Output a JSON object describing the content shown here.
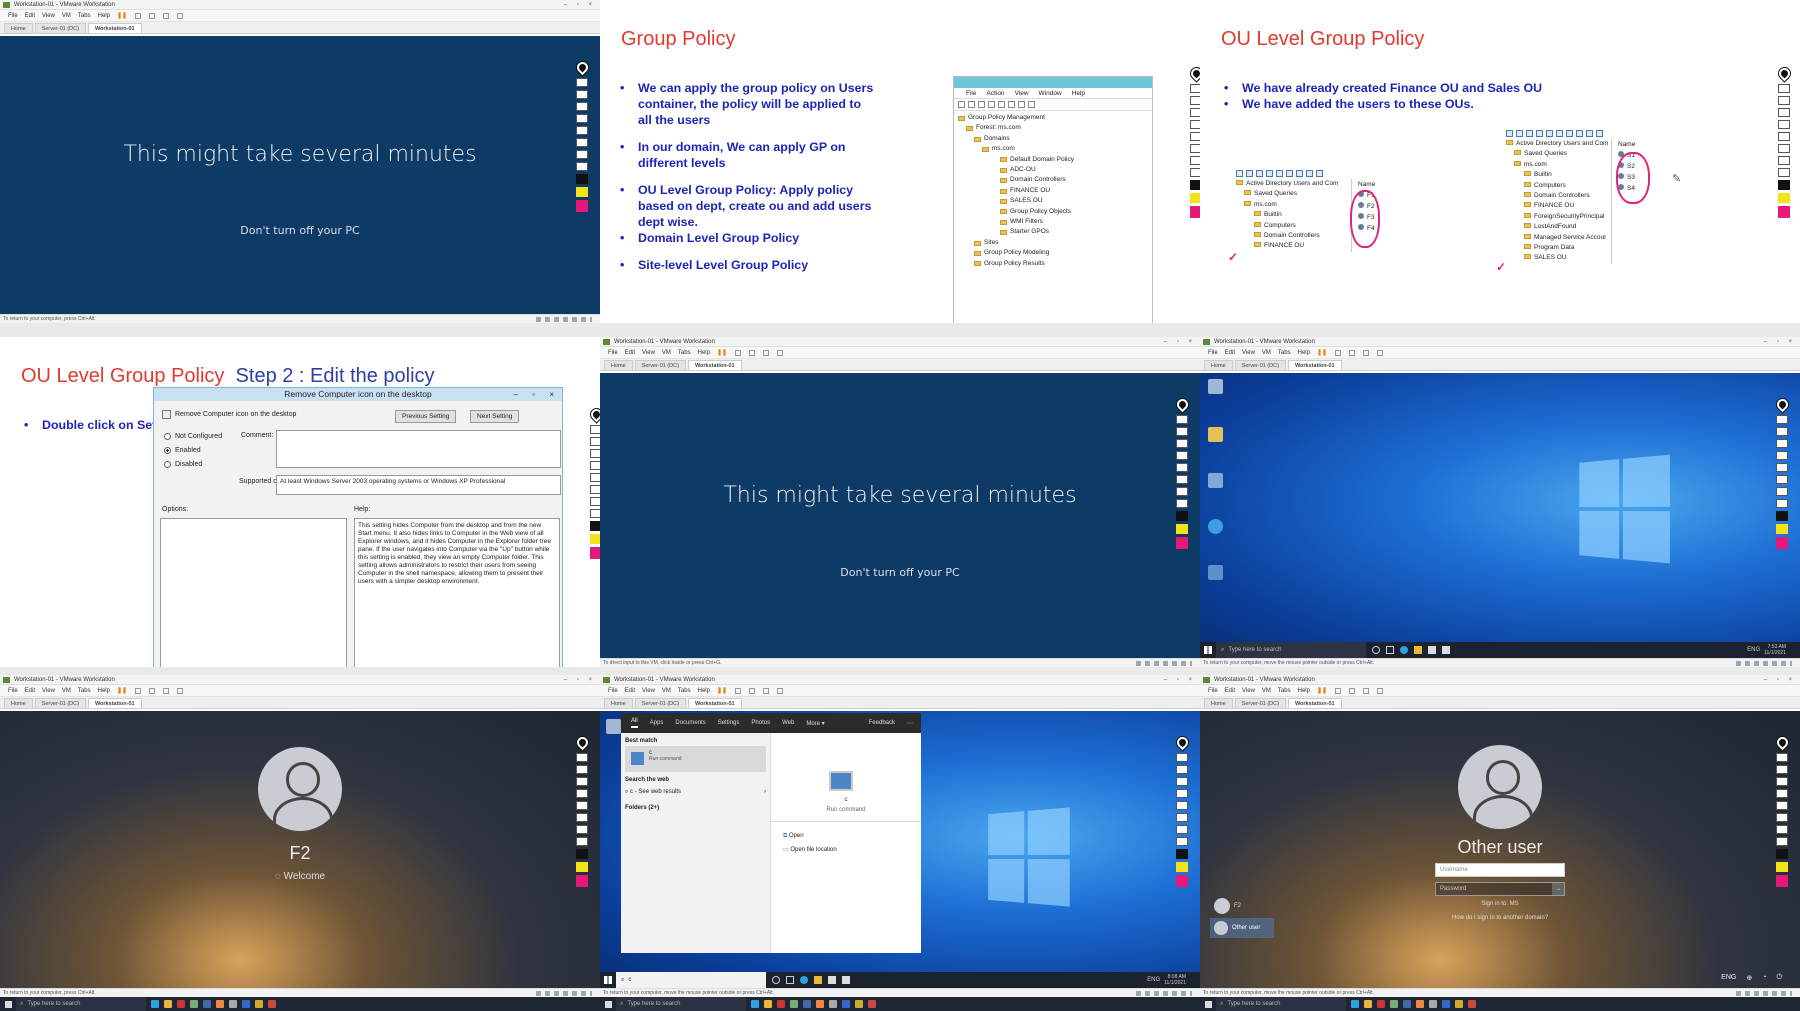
{
  "vmware": {
    "window_title": "Workstation-01 - VMware Workstation",
    "menu": [
      "File",
      "Edit",
      "View",
      "VM",
      "Tabs",
      "Help"
    ],
    "tabs": [
      "Home",
      "Server-01 (DC)",
      "Workstation-01"
    ],
    "status_return": "To return to your computer, press Ctrl+Alt.",
    "status_direct": "To direct input to this VM, click inside or press Ctrl+G.",
    "status_move": "To return to your computer, move the mouse pointer outside or press Ctrl+Alt."
  },
  "updating": {
    "main": "This might take several minutes",
    "sub": "Don't turn off your PC"
  },
  "slide_gp": {
    "title": "Group Policy",
    "bullets": [
      "We can apply the group policy on Users container, the policy will be applied to all the users",
      "In our domain, We can apply GP on different levels",
      "OU Level Group Policy: Apply policy based on dept, create ou and add users dept wise.",
      "Domain Level Group Policy",
      "Site-level Level Group Policy"
    ],
    "gpm_menu": [
      "File",
      "Action",
      "View",
      "Window",
      "Help"
    ],
    "gpm_tree": [
      "Group Policy Management",
      "Forest: ms.com",
      "Domains",
      "ms.com",
      "Default Domain Policy",
      "ADC-OU",
      "Domain Controllers",
      "FINANCE OU",
      "SALES OU",
      "Group Policy Objects",
      "WMI Filters",
      "Starter GPOs",
      "Sites",
      "Group Policy Modeling",
      "Group Policy Results"
    ]
  },
  "slide_ou": {
    "title": "OU Level Group Policy",
    "bullets": [
      "We have already created Finance OU and Sales OU",
      "We have added the users to these OUs."
    ],
    "ad1_tree": [
      "Active Directory Users and Com",
      "Saved Queries",
      "ms.com",
      "Builtin",
      "Computers",
      "Domain Controllers",
      "FINANCE OU"
    ],
    "ad1_header": "Name",
    "ad1_users": [
      "F1",
      "F2",
      "F3",
      "F4"
    ],
    "ad2_tree": [
      "Active Directory Users and Com",
      "Saved Queries",
      "ms.com",
      "Builtin",
      "Computers",
      "Domain Controllers",
      "FINANCE OU",
      "ForeignSecurityPrincipal",
      "LostAndFound",
      "Managed Service Accour",
      "Program Data",
      "SALES OU"
    ],
    "ad2_header": "Name",
    "ad2_users": [
      "S1",
      "S2",
      "S3",
      "S4"
    ]
  },
  "slide_edit": {
    "title_red": "OU Level Group Policy",
    "title_blue_prefix": "Step 2 :",
    "title_blue_rest": "Edit the policy",
    "bullet": "Double click on Setting - Select Enabled option",
    "dialog_title": "Remove Computer icon on the desktop",
    "setting_name": "Remove Computer icon on the desktop",
    "prev_button": "Previous Setting",
    "next_button": "Next Setting",
    "opt_not_configured": "Not Configured",
    "opt_enabled": "Enabled",
    "opt_disabled": "Disabled",
    "comment_label": "Comment:",
    "supported_label": "Supported on:",
    "supported_value": "At least Windows Server 2003 operating systems or Windows XP Professional",
    "options_label": "Options:",
    "help_label": "Help:",
    "help_text": "This setting hides Computer from the desktop and from the new Start menu. It also hides links to Computer in the Web view of all Explorer windows, and it hides Computer in the Explorer folder tree pane. If the user navigates into Computer via the \"Up\" button while this setting is enabled, they view an empty Computer folder. This setting allows administrators to restrict their users from seeing Computer in the shell namespace, allowing them to present their users with a simpler desktop environment."
  },
  "desktop": {
    "search_placeholder": "Type here to search",
    "time": "7:53 AM",
    "date": "11/1/2021",
    "lang": "ENG"
  },
  "login_f2": {
    "user": "F2",
    "status": "Welcome"
  },
  "startmenu": {
    "tabs": [
      "All",
      "Apps",
      "Documents",
      "Settings",
      "Photos",
      "Web",
      "More ▾"
    ],
    "feedback": "Feedback",
    "best_match": "Best match",
    "best_name": "c",
    "best_sub": "Run command",
    "search_web": "Search the web",
    "web_item": "c - See web results",
    "folders": "Folders (2+)",
    "right_name": "c",
    "right_sub": "Run command",
    "open": "Open",
    "open_location": "Open file location",
    "search_value": "c",
    "time": "8:08 AM",
    "date": "11/1/2021",
    "lang": "ENG"
  },
  "login_other": {
    "title": "Other user",
    "username_placeholder": "Username",
    "password_placeholder": "Password",
    "sign_in_to": "Sign in to: MS",
    "how_to": "How do I sign in to another domain?",
    "users": [
      "F2",
      "Other user"
    ],
    "lang": "ENG"
  },
  "host": {
    "search_placeholder": "Type here to search"
  },
  "colors": {
    "slide_red": "#e03a2f",
    "slide_blue": "#1f24b8",
    "update_blue": "#0e3a66",
    "annot_magenta": "#e0237d"
  }
}
